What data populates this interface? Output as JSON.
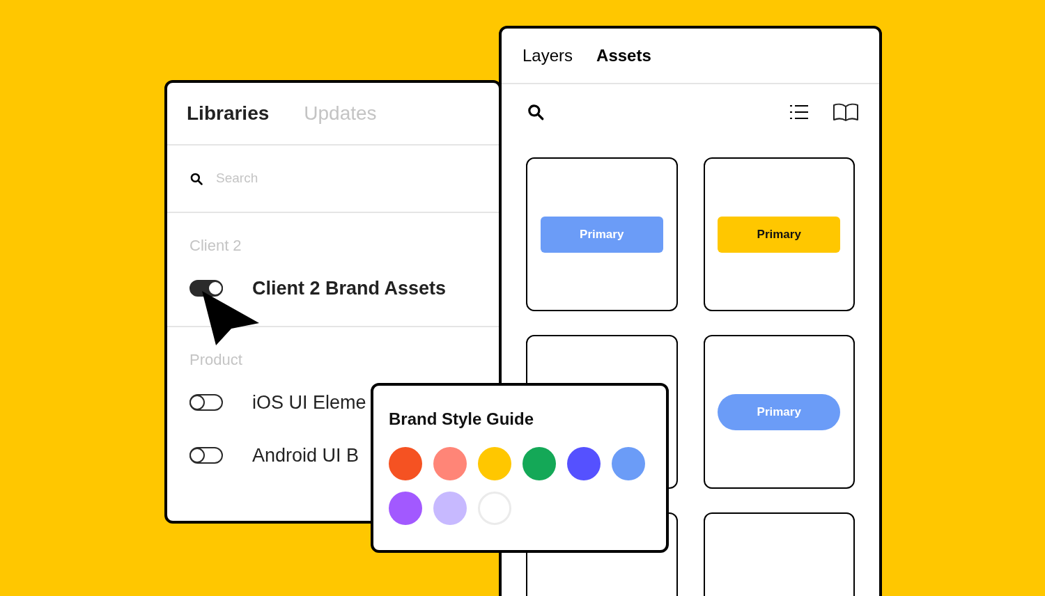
{
  "libraries_panel": {
    "tabs": [
      {
        "label": "Libraries",
        "selected": true
      },
      {
        "label": "Updates",
        "selected": false
      }
    ],
    "search": {
      "placeholder": "Search"
    },
    "groups": [
      {
        "title": "Client 2",
        "items": [
          {
            "name": "Client 2 Brand Assets",
            "on": true
          }
        ]
      },
      {
        "title": "Product",
        "items": [
          {
            "name": "iOS UI Eleme",
            "on": false
          },
          {
            "name": "Android UI B",
            "on": false
          }
        ]
      }
    ]
  },
  "assets_panel": {
    "tabs": [
      {
        "label": "Layers",
        "selected": false
      },
      {
        "label": "Assets",
        "selected": true
      }
    ],
    "cards": [
      {
        "kind": "button",
        "label": "Primary",
        "color": "#6b9cf7"
      },
      {
        "kind": "button",
        "label": "Primary",
        "color": "#ffc700"
      },
      {
        "kind": "empty"
      },
      {
        "kind": "pill",
        "label": "Primary",
        "color": "#6b9cf7"
      },
      {
        "kind": "empty"
      },
      {
        "kind": "empty"
      }
    ]
  },
  "style_guide": {
    "title": "Brand Style Guide",
    "swatches": [
      {
        "color": "#f55222"
      },
      {
        "color": "#ff8577"
      },
      {
        "color": "#ffc700"
      },
      {
        "color": "#14a857"
      },
      {
        "color": "#5551ff"
      },
      {
        "color": "#6b9cf7"
      },
      {
        "color": "#a259ff"
      },
      {
        "color": "#c7b9ff"
      },
      {
        "color": "#ffffff"
      }
    ]
  }
}
